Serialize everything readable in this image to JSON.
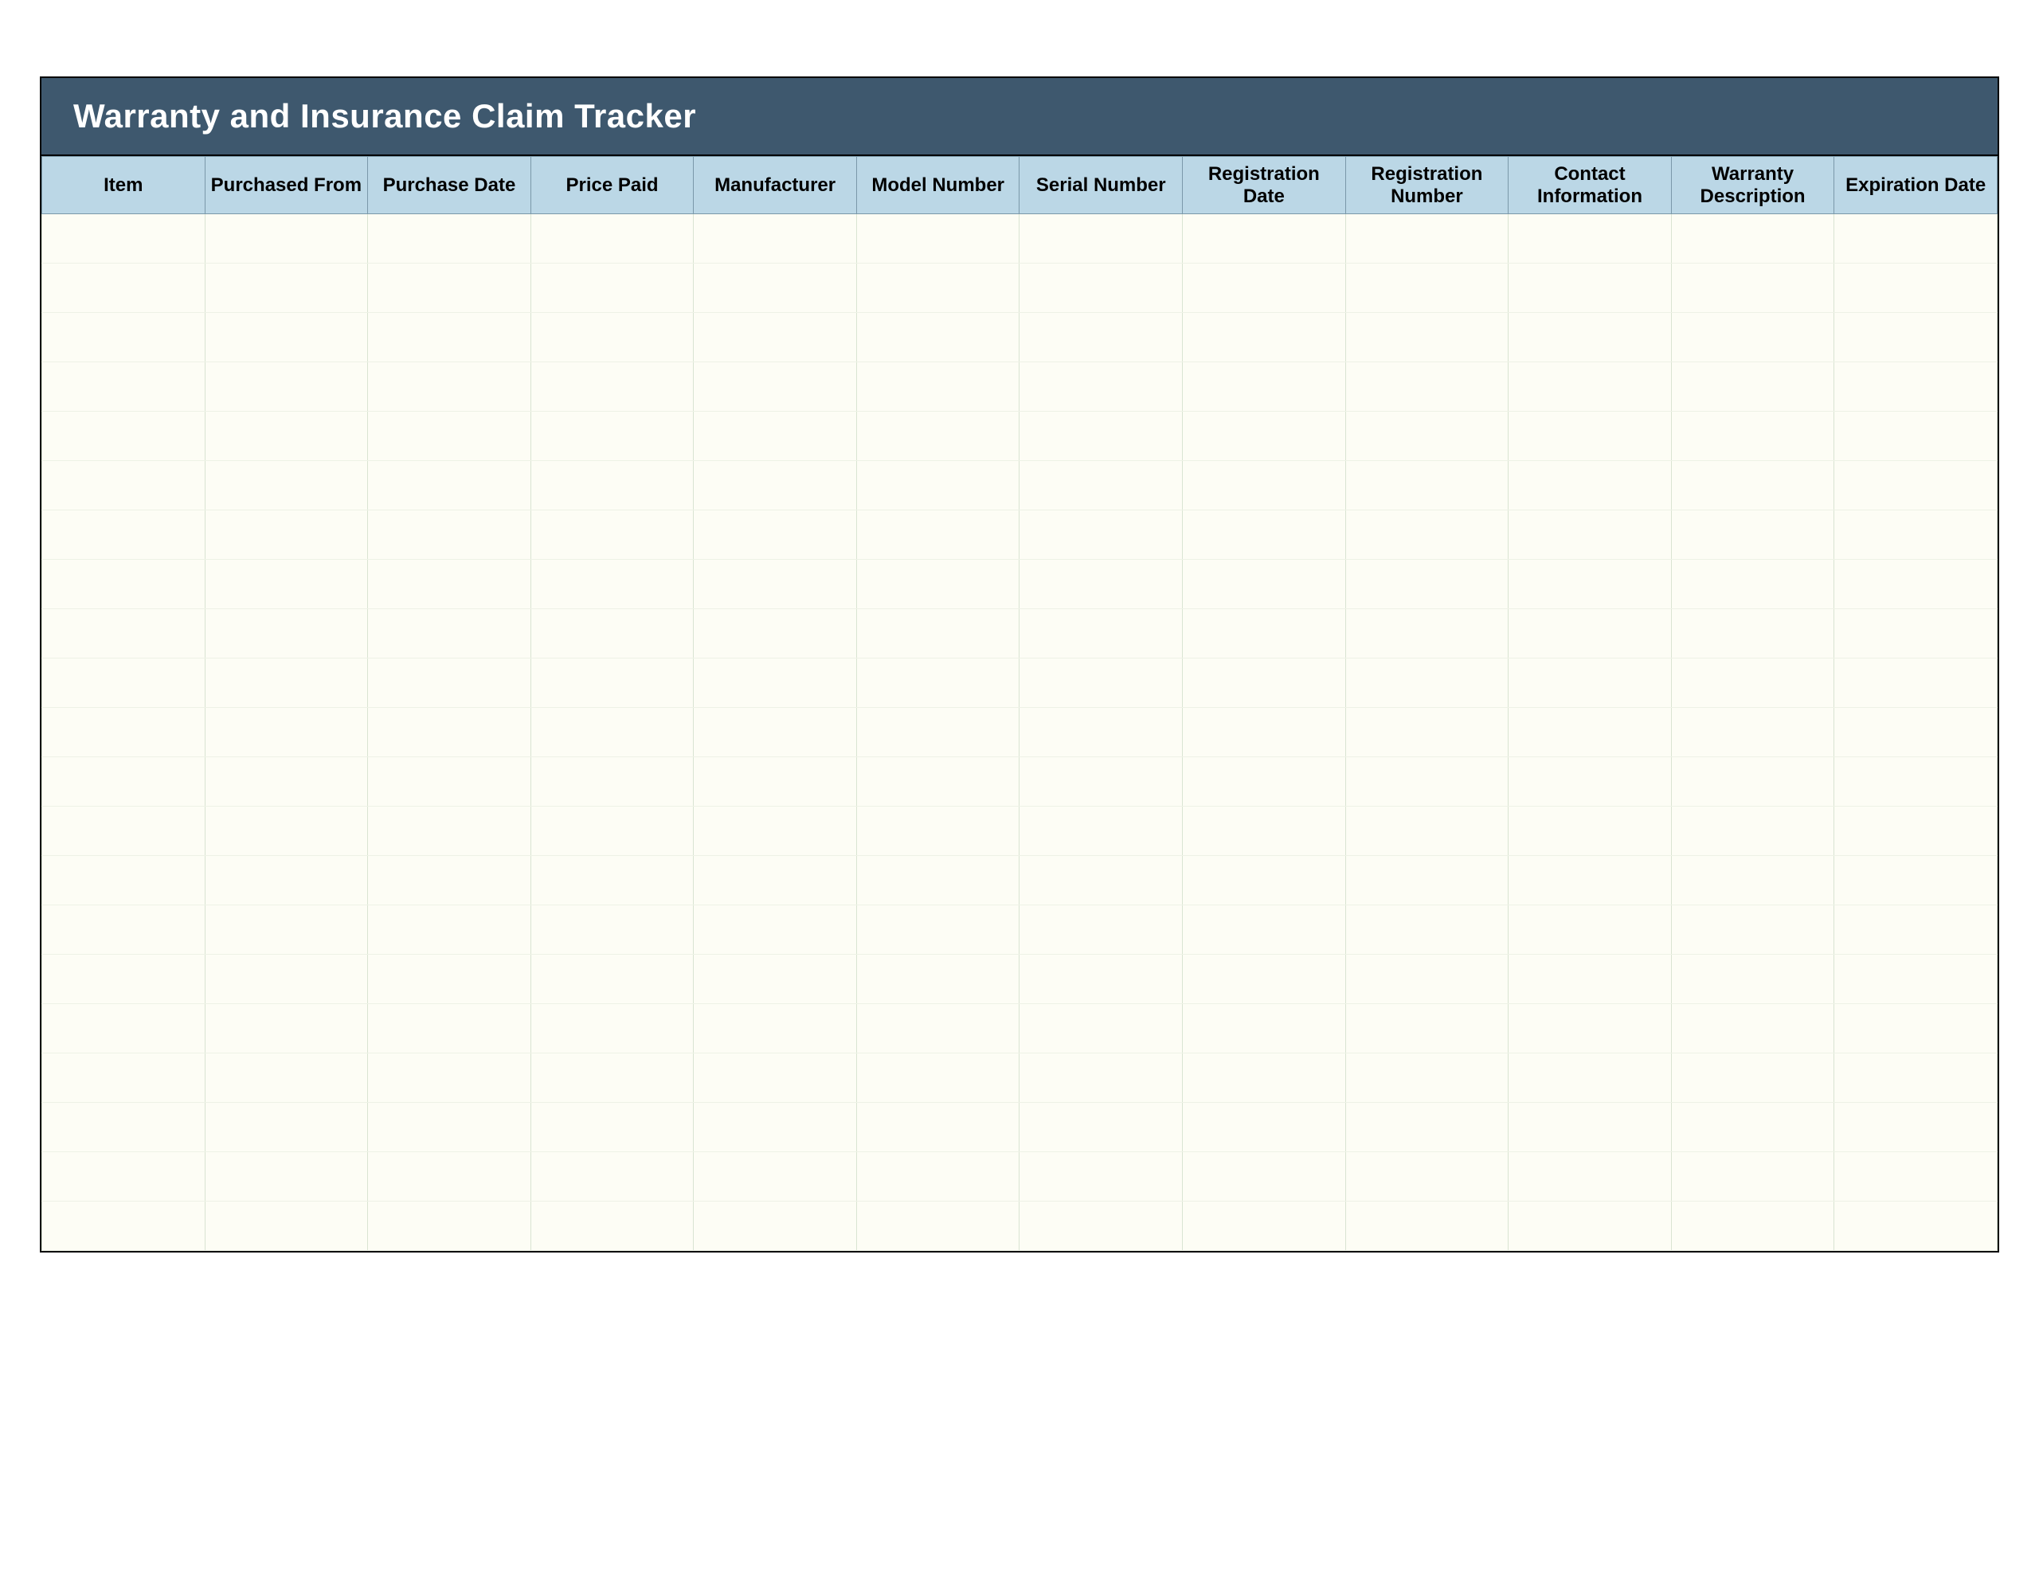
{
  "title": "Warranty and Insurance Claim Tracker",
  "columns": [
    "Item",
    "Purchased From",
    "Purchase Date",
    "Price Paid",
    "Manufacturer",
    "Model Number",
    "Serial Number",
    "Registration Date",
    "Registration Number",
    "Contact Information",
    "Warranty Description",
    "Expiration Date"
  ],
  "row_count": 21
}
